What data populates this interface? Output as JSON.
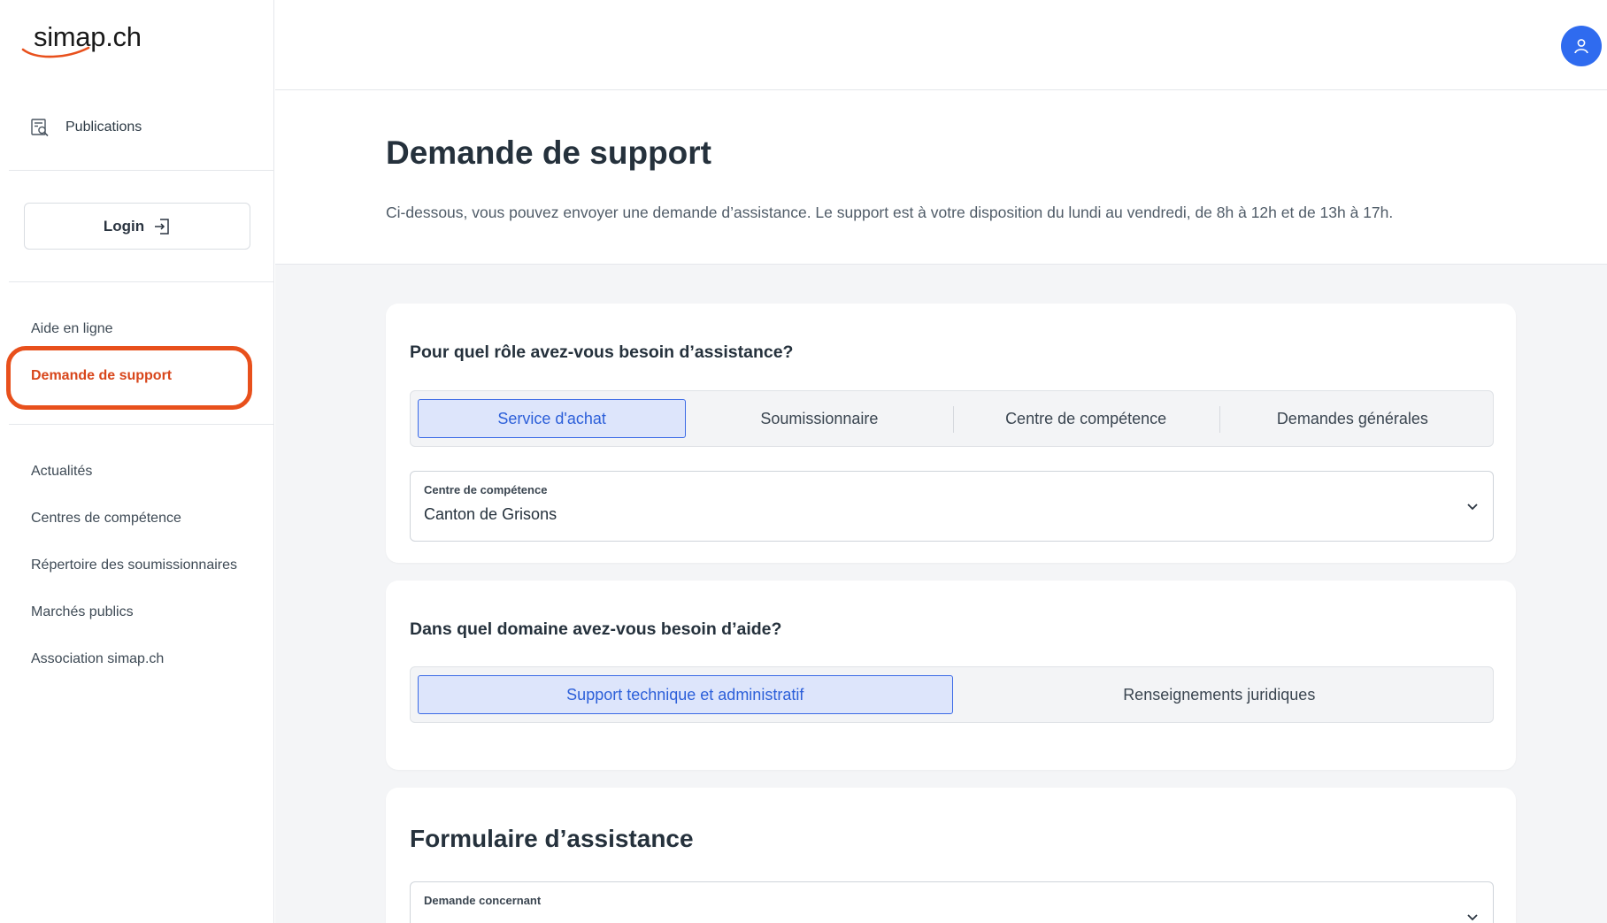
{
  "brand": {
    "logo_text": "simap.ch",
    "accent": "#e8501c"
  },
  "sidebar": {
    "publications_label": "Publications",
    "login_label": "Login",
    "help_items": [
      {
        "label": "Aide en ligne"
      },
      {
        "label": "Demande de support",
        "active": true
      }
    ],
    "nav_items": [
      {
        "label": "Actualités"
      },
      {
        "label": "Centres de compétence"
      },
      {
        "label": "Répertoire des soumissionnaires"
      },
      {
        "label": "Marchés publics"
      },
      {
        "label": "Association simap.ch"
      }
    ]
  },
  "header": {
    "title": "Demande de support",
    "description": "Ci-dessous, vous pouvez envoyer une demande d’assistance. Le support est à votre disposition du lundi au vendredi, de 8h à 12h et de 13h à 17h."
  },
  "role_card": {
    "question": "Pour quel rôle avez-vous besoin d’assistance?",
    "options": [
      {
        "label": "Service d'achat",
        "selected": true
      },
      {
        "label": "Soumissionnaire",
        "selected": false
      },
      {
        "label": "Centre de compétence",
        "selected": false
      },
      {
        "label": "Demandes générales",
        "selected": false
      }
    ],
    "select": {
      "label": "Centre de compétence",
      "value": "Canton de Grisons"
    }
  },
  "domain_card": {
    "question": "Dans quel domaine avez-vous besoin d’aide?",
    "options": [
      {
        "label": "Support technique et administratif",
        "selected": true
      },
      {
        "label": "Renseignements juridiques",
        "selected": false
      }
    ]
  },
  "form_card": {
    "title": "Formulaire d’assistance",
    "select": {
      "label": "Demande concernant",
      "value": ""
    }
  },
  "colors": {
    "primary": "#3b6ae6",
    "primary_bg": "#dde5fb",
    "active_link": "#d8461b",
    "avatar": "#2f6bef"
  }
}
